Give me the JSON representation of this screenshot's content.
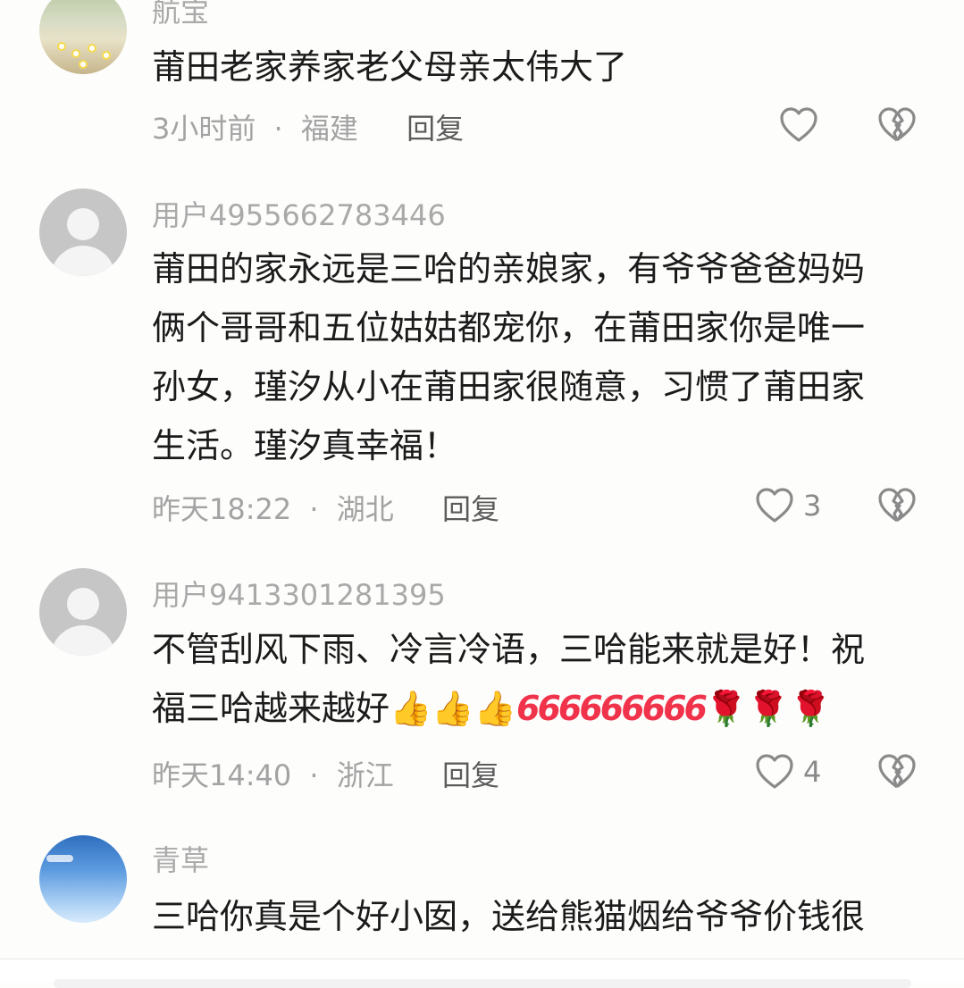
{
  "comments": [
    {
      "username": "航宝",
      "text_lines": [
        "莆田老家养家老父母亲太伟大了"
      ],
      "time": "3小时前",
      "location": "福建",
      "reply_label": "回复",
      "like_count": "",
      "avatar": "flower-photo"
    },
    {
      "username": "用户4955662783446",
      "text_lines": [
        "莆田的家永远是三哈的亲娘家，有爷爷爸爸妈妈",
        "俩个哥哥和五位姑姑都宠你，在莆田家你是唯一",
        "孙女，瑾汐从小在莆田家很随意，习惯了莆田家",
        "生活。瑾汐真幸福！"
      ],
      "time": "昨天18:22",
      "location": "湖北",
      "reply_label": "回复",
      "like_count": "3",
      "avatar": "default"
    },
    {
      "username": "用户9413301281395",
      "text_lines": [
        "不管刮风下雨、冷言冷语，三哈能来就是好！祝",
        "福三哈越来越好"
      ],
      "emoji_tail": [
        "👍",
        "👍",
        "👍",
        "666",
        "666",
        "666",
        "🌹",
        "🌹",
        "🌹"
      ],
      "time": "昨天14:40",
      "location": "浙江",
      "reply_label": "回复",
      "like_count": "4",
      "avatar": "default"
    },
    {
      "username": "青草",
      "text_lines": [
        "三哈你真是个好小囡，送给熊猫烟给爷爷价钱很"
      ],
      "avatar": "sky-photo"
    }
  ],
  "separator": "·",
  "icons": {
    "like": "heart-outline-icon",
    "dislike": "broken-heart-icon"
  }
}
